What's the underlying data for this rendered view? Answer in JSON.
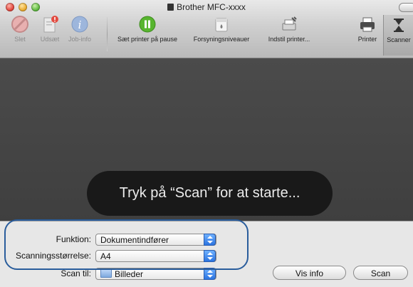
{
  "window": {
    "title": "Brother MFC-xxxx"
  },
  "toolbar": {
    "items": [
      {
        "label": "Slet",
        "icon": "delete-icon",
        "enabled": false
      },
      {
        "label": "Udsæt",
        "icon": "hold-icon",
        "enabled": false
      },
      {
        "label": "Job-info",
        "icon": "info-icon",
        "enabled": false
      },
      {
        "label": "Sæt printer på pause",
        "icon": "pause-icon",
        "enabled": true
      },
      {
        "label": "Forsyningsniveauer",
        "icon": "supply-levels-icon",
        "enabled": true
      },
      {
        "label": "Indstil printer...",
        "icon": "printer-setup-icon",
        "enabled": true
      },
      {
        "label": "Printer",
        "icon": "printer-icon",
        "enabled": true
      },
      {
        "label": "Scanner",
        "icon": "scanner-icon",
        "enabled": true
      }
    ]
  },
  "hud": {
    "message": "Tryk på “Scan” for at starte..."
  },
  "settings": {
    "function": {
      "label": "Funktion:",
      "value": "Dokumentindfører"
    },
    "scan_size": {
      "label": "Scanningsstørrelse:",
      "value": "A4"
    },
    "scan_to": {
      "label": "Scan til:",
      "value": "Billeder"
    }
  },
  "buttons": {
    "show_info": "Vis info",
    "scan": "Scan"
  },
  "colors": {
    "accent": "#2c74e0",
    "highlight": "#2a5d9c",
    "content_bg": "#454545"
  }
}
